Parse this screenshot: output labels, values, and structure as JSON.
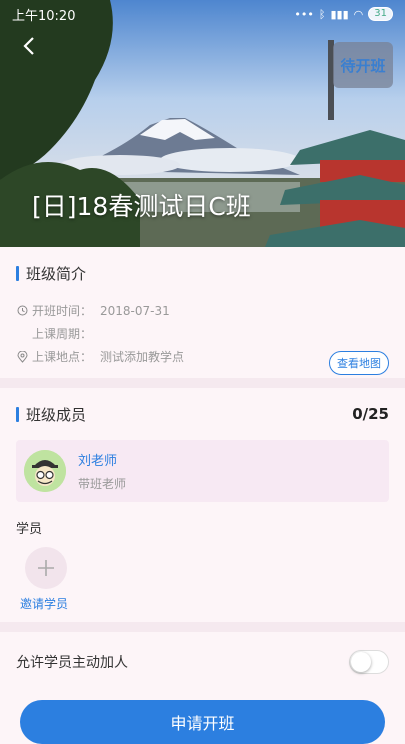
{
  "status_bar": {
    "time": "上午10:20",
    "battery": "31"
  },
  "header": {
    "status_button": "待开班",
    "class_title": "[日]18春测试日C班"
  },
  "intro": {
    "title": "班级简介",
    "start_label": "开班时间：",
    "start_value": "2018-07-31",
    "cycle_label": "上课周期：",
    "cycle_value": "",
    "location_label": "上课地点：",
    "location_value": "测试添加教学点",
    "map_button": "查看地图"
  },
  "members": {
    "title": "班级成员",
    "count": "0/25",
    "teacher_name": "刘老师",
    "teacher_role": "带班老师",
    "students_label": "学员",
    "invite_label": "邀请学员"
  },
  "settings": {
    "allow_join_label": "允许学员主动加人",
    "allow_join_enabled": false
  },
  "footer": {
    "apply_button": "申请开班"
  },
  "colors": {
    "accent": "#2c7fe0",
    "background": "#fdf5f8"
  }
}
